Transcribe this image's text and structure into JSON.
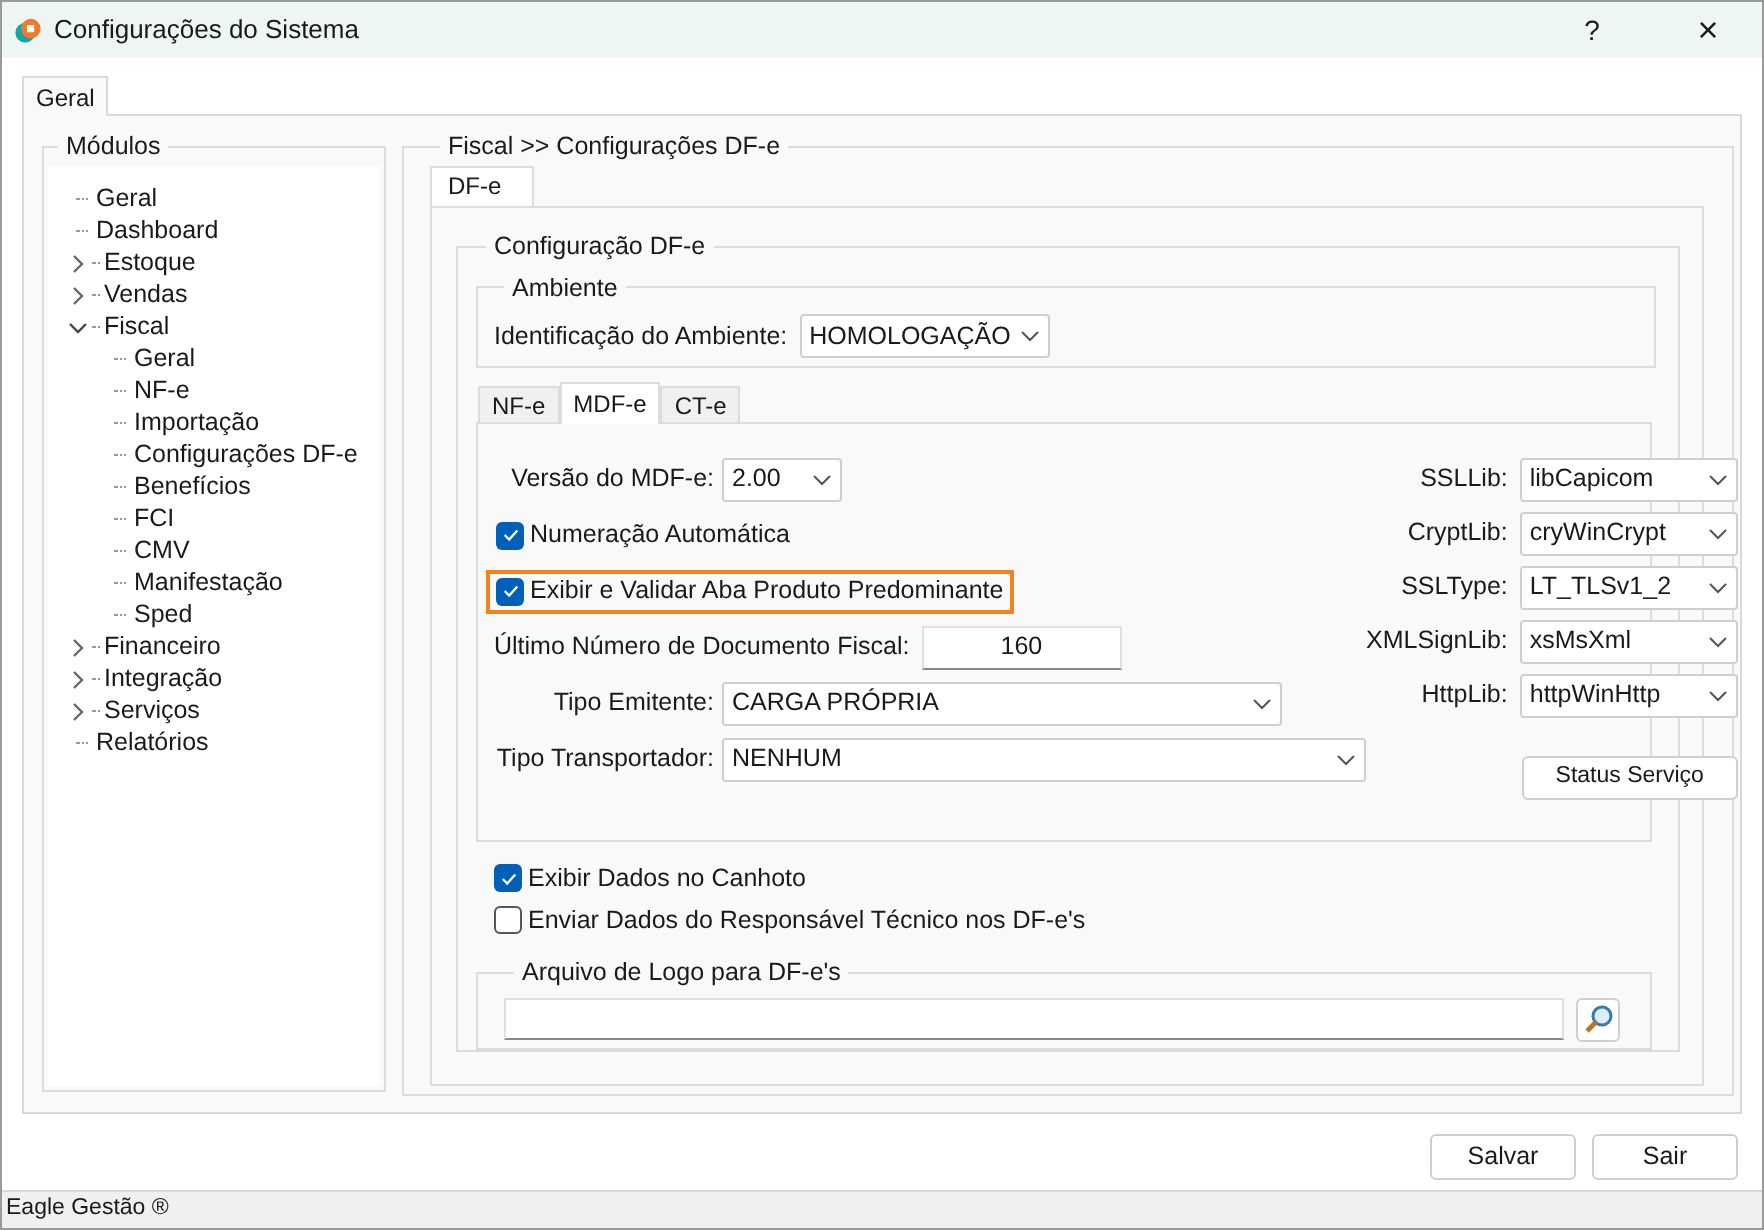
{
  "window": {
    "title": "Configurações do Sistema",
    "help": "?",
    "close": "×"
  },
  "tabs": [
    {
      "label": "Geral",
      "selected": true
    }
  ],
  "modules": {
    "title": "Módulos",
    "tree": [
      {
        "label": "Geral",
        "kind": "leaf"
      },
      {
        "label": "Dashboard",
        "kind": "leaf"
      },
      {
        "label": "Estoque",
        "kind": "branch",
        "expanded": false
      },
      {
        "label": "Vendas",
        "kind": "branch",
        "expanded": false
      },
      {
        "label": "Fiscal",
        "kind": "branch",
        "expanded": true,
        "children": [
          {
            "label": "Geral",
            "kind": "leaf"
          },
          {
            "label": "NF-e",
            "kind": "leaf"
          },
          {
            "label": "Importação",
            "kind": "leaf"
          },
          {
            "label": "Configurações DF-e",
            "kind": "leaf"
          },
          {
            "label": "Benefícios",
            "kind": "leaf"
          },
          {
            "label": "FCI",
            "kind": "leaf"
          },
          {
            "label": "CMV",
            "kind": "leaf"
          },
          {
            "label": "Manifestação",
            "kind": "leaf"
          },
          {
            "label": "Sped",
            "kind": "leaf"
          }
        ]
      },
      {
        "label": "Financeiro",
        "kind": "branch",
        "expanded": false
      },
      {
        "label": "Integração",
        "kind": "branch",
        "expanded": false
      },
      {
        "label": "Serviços",
        "kind": "branch",
        "expanded": false
      },
      {
        "label": "Relatórios",
        "kind": "leaf"
      }
    ]
  },
  "settings": {
    "title": "Fiscal >> Configurações DF-e",
    "tabs": [
      {
        "label": "DF-e",
        "selected": true
      }
    ],
    "group_title": "Configuração DF-e",
    "environment": {
      "title": "Ambiente",
      "label": "Identificação do Ambiente:",
      "value": "HOMOLOGAÇÃO"
    },
    "doc_tabs": [
      {
        "label": "NF-e",
        "selected": false
      },
      {
        "label": "MDF-e",
        "selected": true
      },
      {
        "label": "CT-e",
        "selected": false
      }
    ],
    "mdfe_fields": [
      {
        "kind": "select",
        "label": "Versão do MDF-e:",
        "value": "2.00"
      },
      {
        "kind": "checkbox",
        "label": "Numeração Automática",
        "checked": true,
        "highlighted": false
      },
      {
        "kind": "checkbox",
        "label": "Exibir e Validar Aba Produto Predominante",
        "checked": true,
        "highlighted": true
      },
      {
        "kind": "text",
        "label": "Último Número de Documento Fiscal:",
        "value": "160"
      },
      {
        "kind": "select",
        "label": "Tipo Emitente:",
        "value": "CARGA PRÓPRIA"
      },
      {
        "kind": "select",
        "label": "Tipo Transportador:",
        "value": "NENHUM"
      }
    ],
    "libraries": [
      {
        "label": "SSLLib:",
        "value": "libCapicom"
      },
      {
        "label": "CryptLib:",
        "value": "cryWinCrypt"
      },
      {
        "label": "SSLType:",
        "value": "LT_TLSv1_2"
      },
      {
        "label": "XMLSignLib:",
        "value": "xsMsXml"
      },
      {
        "label": "HttpLib:",
        "value": "httpWinHttp"
      }
    ],
    "status_button": "Status Serviço",
    "options": [
      {
        "label": "Exibir Dados no Canhoto",
        "checked": true
      },
      {
        "label": "Enviar Dados do Responsável Técnico nos DF-e's",
        "checked": false
      }
    ],
    "logo": {
      "title": "Arquivo de Logo para DF-e's"
    }
  },
  "buttons": [
    "Salvar",
    "Sair"
  ],
  "status_bar": "Eagle Gestão ®"
}
